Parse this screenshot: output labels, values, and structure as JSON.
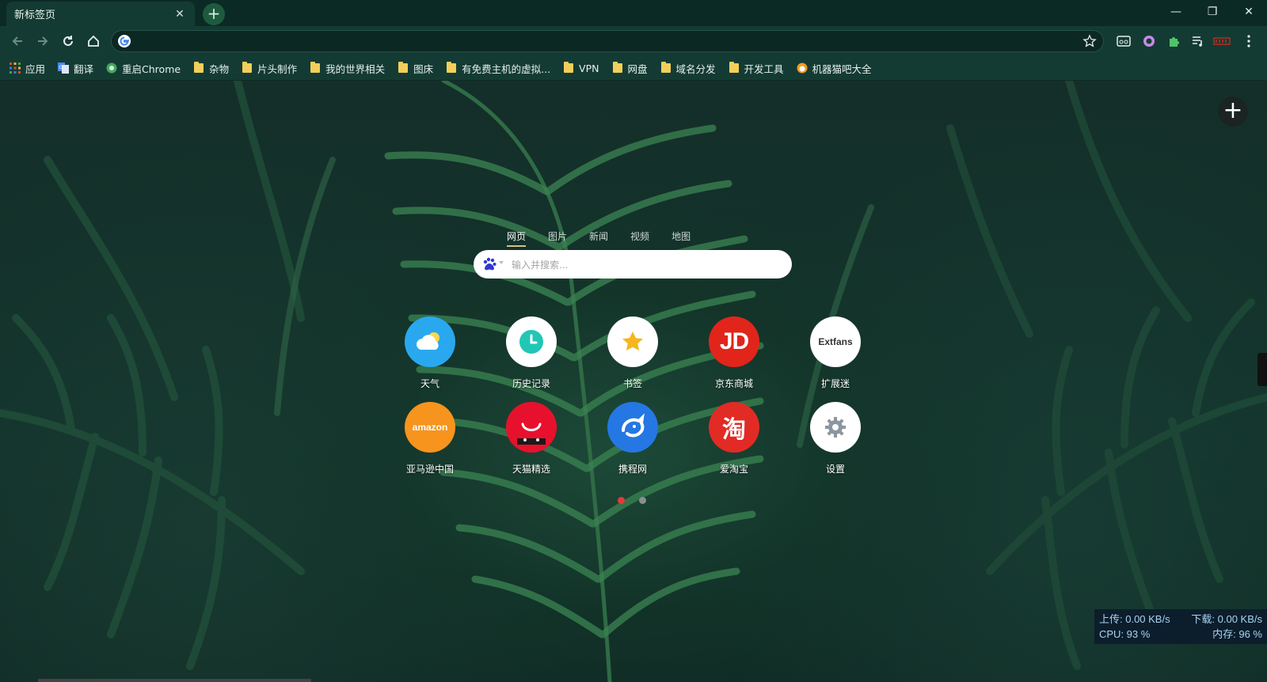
{
  "tab": {
    "title": "新标签页"
  },
  "omnibox": {
    "value": "",
    "placeholder": ""
  },
  "bookmarks": [
    {
      "label": "应用",
      "icon": "apps-grid-icon"
    },
    {
      "label": "翻译",
      "icon": "translate-icon"
    },
    {
      "label": "重启Chrome",
      "icon": "restart-icon"
    },
    {
      "label": "杂物",
      "icon": "folder-icon"
    },
    {
      "label": "片头制作",
      "icon": "folder-icon"
    },
    {
      "label": "我的世界相关",
      "icon": "folder-icon"
    },
    {
      "label": "图床",
      "icon": "folder-icon"
    },
    {
      "label": "有免费主机的虚拟...",
      "icon": "folder-icon"
    },
    {
      "label": "VPN",
      "icon": "folder-icon"
    },
    {
      "label": "网盘",
      "icon": "folder-icon"
    },
    {
      "label": "域名分发",
      "icon": "folder-icon"
    },
    {
      "label": "开发工具",
      "icon": "folder-icon"
    },
    {
      "label": "机器猫吧大全",
      "icon": "doraemon-icon"
    }
  ],
  "search": {
    "tabs": [
      "网页",
      "图片",
      "新闻",
      "视频",
      "地图"
    ],
    "active_tab": "网页",
    "placeholder": "输入并搜索..."
  },
  "apps": [
    {
      "label": "天气",
      "icon": "weather-icon",
      "color": "#29a8f0"
    },
    {
      "label": "历史记录",
      "icon": "clock-icon",
      "color": "#ffffff"
    },
    {
      "label": "书签",
      "icon": "star-icon",
      "color": "#ffffff"
    },
    {
      "label": "京东商城",
      "icon": "jd-logo-icon",
      "color": "#e1251b",
      "text": "JD"
    },
    {
      "label": "扩展迷",
      "icon": "extfans-logo-icon",
      "color": "#ffffff",
      "text": "Extfans"
    },
    {
      "label": "亚马逊中国",
      "icon": "amazon-logo-icon",
      "color": "#f7941d",
      "text": "amazon"
    },
    {
      "label": "天猫精选",
      "icon": "tmall-logo-icon",
      "color": "#e8112d"
    },
    {
      "label": "携程网",
      "icon": "ctrip-dolphin-icon",
      "color": "#2577e3"
    },
    {
      "label": "爱淘宝",
      "icon": "taobao-logo-icon",
      "color": "#e22b24",
      "text": "淘"
    },
    {
      "label": "设置",
      "icon": "gear-icon",
      "color": "#ffffff"
    }
  ],
  "pager": {
    "pages": 2,
    "current": 1
  },
  "monitor": {
    "upload": "上传: 0.00 KB/s",
    "download": "下载: 0.00 KB/s",
    "cpu": "CPU: 93 %",
    "memory": "内存: 96 %"
  },
  "colors": {
    "accent": "#d7c08a",
    "page_dot_active": "#e23b3b",
    "page_dot_inactive": "#8a8f8d"
  }
}
